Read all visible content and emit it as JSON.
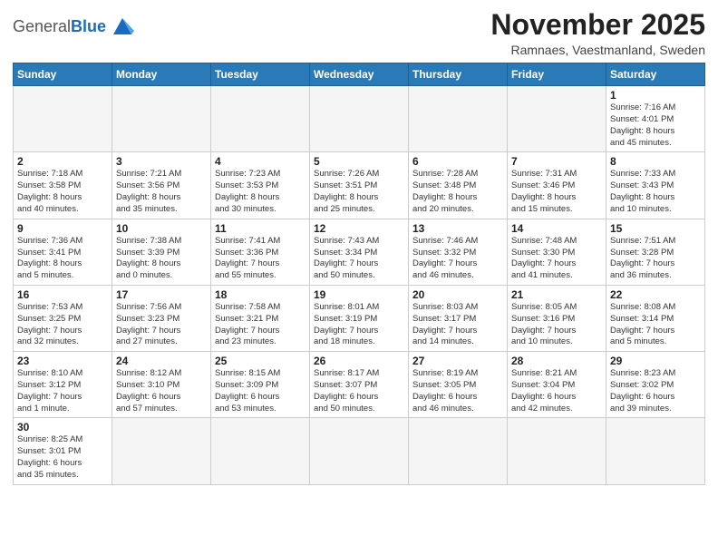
{
  "header": {
    "logo_general": "General",
    "logo_blue": "Blue",
    "month_year": "November 2025",
    "location": "Ramnaes, Vaestmanland, Sweden"
  },
  "weekdays": [
    "Sunday",
    "Monday",
    "Tuesday",
    "Wednesday",
    "Thursday",
    "Friday",
    "Saturday"
  ],
  "weeks": [
    [
      {
        "day": "",
        "info": ""
      },
      {
        "day": "",
        "info": ""
      },
      {
        "day": "",
        "info": ""
      },
      {
        "day": "",
        "info": ""
      },
      {
        "day": "",
        "info": ""
      },
      {
        "day": "",
        "info": ""
      },
      {
        "day": "1",
        "info": "Sunrise: 7:16 AM\nSunset: 4:01 PM\nDaylight: 8 hours\nand 45 minutes."
      }
    ],
    [
      {
        "day": "2",
        "info": "Sunrise: 7:18 AM\nSunset: 3:58 PM\nDaylight: 8 hours\nand 40 minutes."
      },
      {
        "day": "3",
        "info": "Sunrise: 7:21 AM\nSunset: 3:56 PM\nDaylight: 8 hours\nand 35 minutes."
      },
      {
        "day": "4",
        "info": "Sunrise: 7:23 AM\nSunset: 3:53 PM\nDaylight: 8 hours\nand 30 minutes."
      },
      {
        "day": "5",
        "info": "Sunrise: 7:26 AM\nSunset: 3:51 PM\nDaylight: 8 hours\nand 25 minutes."
      },
      {
        "day": "6",
        "info": "Sunrise: 7:28 AM\nSunset: 3:48 PM\nDaylight: 8 hours\nand 20 minutes."
      },
      {
        "day": "7",
        "info": "Sunrise: 7:31 AM\nSunset: 3:46 PM\nDaylight: 8 hours\nand 15 minutes."
      },
      {
        "day": "8",
        "info": "Sunrise: 7:33 AM\nSunset: 3:43 PM\nDaylight: 8 hours\nand 10 minutes."
      }
    ],
    [
      {
        "day": "9",
        "info": "Sunrise: 7:36 AM\nSunset: 3:41 PM\nDaylight: 8 hours\nand 5 minutes."
      },
      {
        "day": "10",
        "info": "Sunrise: 7:38 AM\nSunset: 3:39 PM\nDaylight: 8 hours\nand 0 minutes."
      },
      {
        "day": "11",
        "info": "Sunrise: 7:41 AM\nSunset: 3:36 PM\nDaylight: 7 hours\nand 55 minutes."
      },
      {
        "day": "12",
        "info": "Sunrise: 7:43 AM\nSunset: 3:34 PM\nDaylight: 7 hours\nand 50 minutes."
      },
      {
        "day": "13",
        "info": "Sunrise: 7:46 AM\nSunset: 3:32 PM\nDaylight: 7 hours\nand 46 minutes."
      },
      {
        "day": "14",
        "info": "Sunrise: 7:48 AM\nSunset: 3:30 PM\nDaylight: 7 hours\nand 41 minutes."
      },
      {
        "day": "15",
        "info": "Sunrise: 7:51 AM\nSunset: 3:28 PM\nDaylight: 7 hours\nand 36 minutes."
      }
    ],
    [
      {
        "day": "16",
        "info": "Sunrise: 7:53 AM\nSunset: 3:25 PM\nDaylight: 7 hours\nand 32 minutes."
      },
      {
        "day": "17",
        "info": "Sunrise: 7:56 AM\nSunset: 3:23 PM\nDaylight: 7 hours\nand 27 minutes."
      },
      {
        "day": "18",
        "info": "Sunrise: 7:58 AM\nSunset: 3:21 PM\nDaylight: 7 hours\nand 23 minutes."
      },
      {
        "day": "19",
        "info": "Sunrise: 8:01 AM\nSunset: 3:19 PM\nDaylight: 7 hours\nand 18 minutes."
      },
      {
        "day": "20",
        "info": "Sunrise: 8:03 AM\nSunset: 3:17 PM\nDaylight: 7 hours\nand 14 minutes."
      },
      {
        "day": "21",
        "info": "Sunrise: 8:05 AM\nSunset: 3:16 PM\nDaylight: 7 hours\nand 10 minutes."
      },
      {
        "day": "22",
        "info": "Sunrise: 8:08 AM\nSunset: 3:14 PM\nDaylight: 7 hours\nand 5 minutes."
      }
    ],
    [
      {
        "day": "23",
        "info": "Sunrise: 8:10 AM\nSunset: 3:12 PM\nDaylight: 7 hours\nand 1 minute."
      },
      {
        "day": "24",
        "info": "Sunrise: 8:12 AM\nSunset: 3:10 PM\nDaylight: 6 hours\nand 57 minutes."
      },
      {
        "day": "25",
        "info": "Sunrise: 8:15 AM\nSunset: 3:09 PM\nDaylight: 6 hours\nand 53 minutes."
      },
      {
        "day": "26",
        "info": "Sunrise: 8:17 AM\nSunset: 3:07 PM\nDaylight: 6 hours\nand 50 minutes."
      },
      {
        "day": "27",
        "info": "Sunrise: 8:19 AM\nSunset: 3:05 PM\nDaylight: 6 hours\nand 46 minutes."
      },
      {
        "day": "28",
        "info": "Sunrise: 8:21 AM\nSunset: 3:04 PM\nDaylight: 6 hours\nand 42 minutes."
      },
      {
        "day": "29",
        "info": "Sunrise: 8:23 AM\nSunset: 3:02 PM\nDaylight: 6 hours\nand 39 minutes."
      }
    ],
    [
      {
        "day": "30",
        "info": "Sunrise: 8:25 AM\nSunset: 3:01 PM\nDaylight: 6 hours\nand 35 minutes."
      },
      {
        "day": "",
        "info": ""
      },
      {
        "day": "",
        "info": ""
      },
      {
        "day": "",
        "info": ""
      },
      {
        "day": "",
        "info": ""
      },
      {
        "day": "",
        "info": ""
      },
      {
        "day": "",
        "info": ""
      }
    ]
  ]
}
